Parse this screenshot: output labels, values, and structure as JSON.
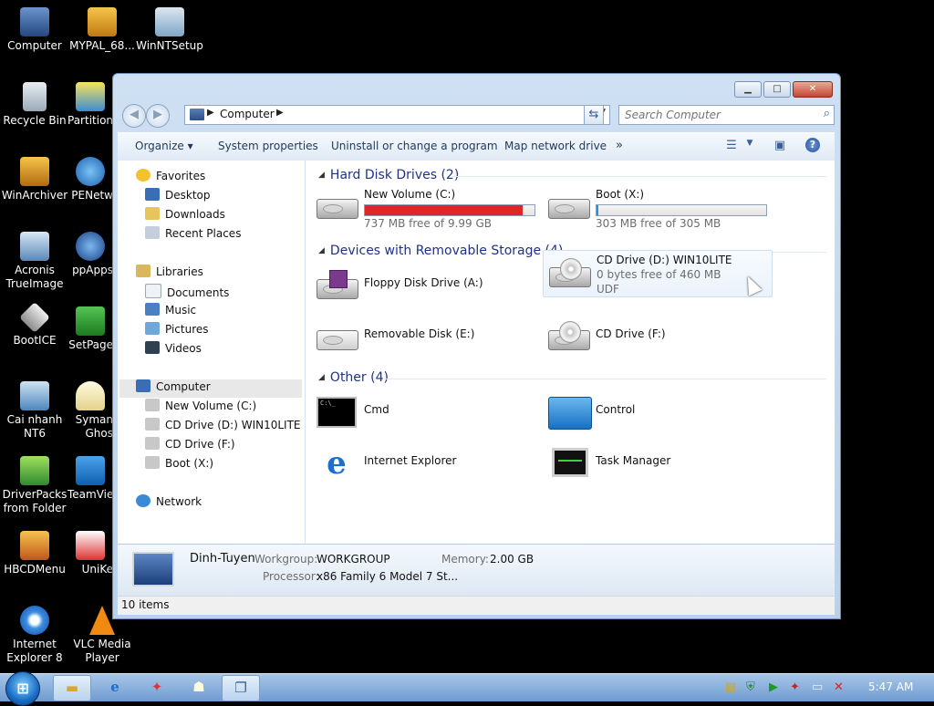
{
  "desktop": {
    "icons": [
      {
        "label": "Computer"
      },
      {
        "label": "MYPAL_68..."
      },
      {
        "label": "WinNTSetup"
      },
      {
        "label": "Recycle Bin"
      },
      {
        "label": "Partition"
      },
      {
        "label": "WinArchiver"
      },
      {
        "label": "PENetw"
      },
      {
        "label": "Acronis\nTrueImage"
      },
      {
        "label": "ppApps"
      },
      {
        "label": "BootICE"
      },
      {
        "label": "SetPage"
      },
      {
        "label": "Cai nhanh\nNT6"
      },
      {
        "label": "Syman\nGhos"
      },
      {
        "label": "DriverPacks\nfrom Folder"
      },
      {
        "label": "TeamVie"
      },
      {
        "label": "HBCDMenu"
      },
      {
        "label": "UniKe"
      },
      {
        "label": "Internet\nExplorer 8"
      },
      {
        "label": "VLC Media\nPlayer"
      }
    ]
  },
  "window": {
    "caption": {
      "minimize": "▁",
      "maximize": "□",
      "close": "✕"
    },
    "address": {
      "location": "Computer",
      "refresh": "⇆"
    },
    "search": {
      "placeholder": "Search Computer"
    },
    "toolbar": {
      "organize": "Organize ▾",
      "system_properties": "System properties",
      "uninstall": "Uninstall or change a program",
      "map_drive": "Map network drive",
      "more": "»"
    },
    "nav": {
      "favorites": "Favorites",
      "desktop": "Desktop",
      "downloads": "Downloads",
      "recent_places": "Recent Places",
      "libraries": "Libraries",
      "documents": "Documents",
      "music": "Music",
      "pictures": "Pictures",
      "videos": "Videos",
      "computer": "Computer",
      "drive_c": "New Volume (C:)",
      "drive_d": "CD Drive (D:) WIN10LITE",
      "drive_f": "CD Drive (F:)",
      "drive_x": "Boot (X:)",
      "network": "Network"
    },
    "groups": {
      "hard_disks": "Hard Disk Drives (2)",
      "removable": "Devices with Removable Storage (4)",
      "other": "Other (4)"
    },
    "hard_disks": [
      {
        "name": "New Volume (C:)",
        "free": "737 MB free of 9.99 GB",
        "used_fraction": 0.93,
        "bar_color": "#e0242a"
      },
      {
        "name": "Boot (X:)",
        "free": "303 MB free of 305 MB",
        "used_fraction": 0.01,
        "bar_color": "#2c8fd8"
      }
    ],
    "removable": [
      {
        "name": "Floppy Disk Drive (A:)"
      },
      {
        "name": "CD Drive (D:) WIN10LITE",
        "free": "0 bytes free of 460 MB",
        "fs": "UDF"
      },
      {
        "name": "Removable Disk (E:)"
      },
      {
        "name": "CD Drive (F:)"
      }
    ],
    "other": [
      {
        "name": "Cmd"
      },
      {
        "name": "Control"
      },
      {
        "name": "Internet Explorer"
      },
      {
        "name": "Task Manager"
      }
    ],
    "details": {
      "computer_name": "Dinh-Tuyen",
      "workgroup_label": "Workgroup:",
      "workgroup": "WORKGROUP",
      "memory_label": "Memory:",
      "memory": "2.00 GB",
      "processor_label": "Processor:",
      "processor": "x86 Family 6 Model 7 St..."
    },
    "status": {
      "items": "10 items"
    }
  },
  "taskbar": {
    "start": "⊞",
    "clock": "5:47 AM"
  }
}
